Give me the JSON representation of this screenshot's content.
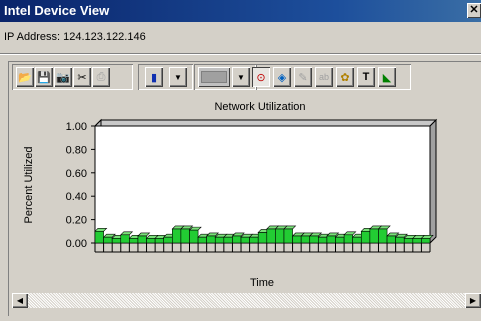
{
  "window": {
    "title": "Intel Device View",
    "close_glyph": "✕"
  },
  "device": {
    "ip_label": "IP Address: 124.123.122.146"
  },
  "toolbar": {
    "buttons": [
      {
        "name": "open-icon",
        "glyph": "📂"
      },
      {
        "name": "save-icon",
        "glyph": "💾"
      },
      {
        "name": "camera-icon",
        "glyph": "📷"
      },
      {
        "name": "cut-icon",
        "glyph": "✂"
      },
      {
        "name": "print-icon",
        "glyph": "⎙"
      },
      {
        "name": "chart-type-icon",
        "glyph": "▮"
      },
      {
        "name": "dropdown-arrow-icon",
        "glyph": "▼"
      },
      {
        "name": "color-dropdown-arrow-icon",
        "glyph": "▼"
      },
      {
        "name": "glasses-icon",
        "glyph": "⊙"
      },
      {
        "name": "rotate-icon",
        "glyph": "◈"
      },
      {
        "name": "edit-disabled-icon",
        "glyph": "✎"
      },
      {
        "name": "text-disabled-icon",
        "glyph": "ab"
      },
      {
        "name": "palette-icon",
        "glyph": "✿"
      },
      {
        "name": "hammer-icon",
        "glyph": "T"
      },
      {
        "name": "axis-chart-icon",
        "glyph": "◣"
      }
    ]
  },
  "chart_data": {
    "type": "bar",
    "title": "Network Utilization",
    "xlabel": "Time",
    "ylabel": "Percent Utilized",
    "ylim": [
      0,
      1
    ],
    "y_ticks": [
      "1.00",
      "0.80",
      "0.60",
      "0.40",
      "0.20",
      "0.00"
    ],
    "bar_color": "#22cc33",
    "values": [
      0.1,
      0.05,
      0.04,
      0.07,
      0.04,
      0.06,
      0.04,
      0.04,
      0.05,
      0.12,
      0.12,
      0.11,
      0.05,
      0.06,
      0.05,
      0.05,
      0.06,
      0.05,
      0.05,
      0.09,
      0.12,
      0.12,
      0.12,
      0.06,
      0.06,
      0.06,
      0.05,
      0.06,
      0.05,
      0.07,
      0.05,
      0.1,
      0.12,
      0.12,
      0.06,
      0.05,
      0.04,
      0.04,
      0.04
    ]
  },
  "scrollbar": {
    "left_glyph": "◀",
    "right_glyph": "▶"
  }
}
